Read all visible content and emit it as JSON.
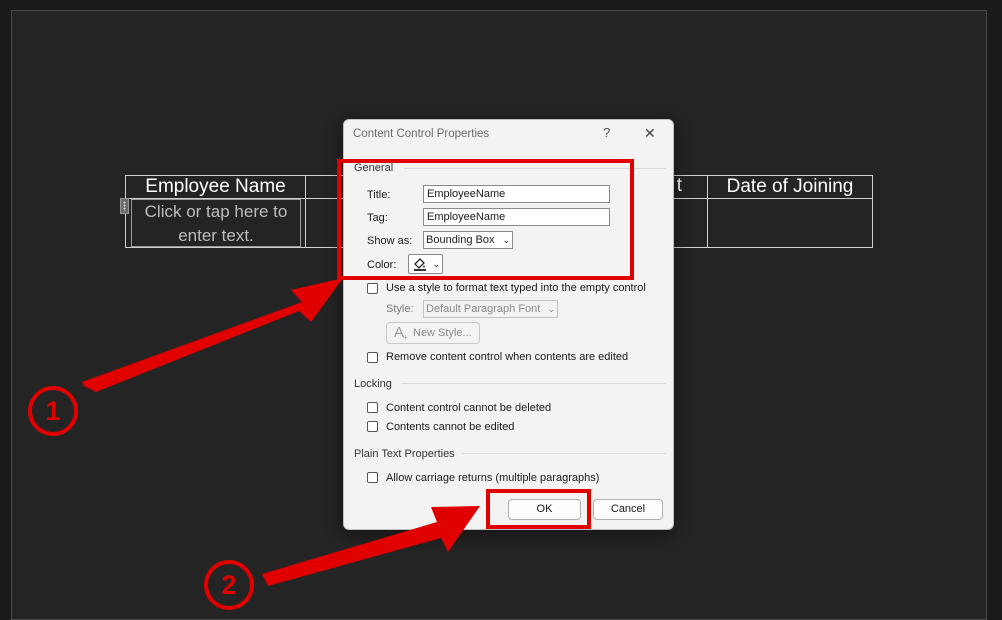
{
  "table": {
    "headers": [
      "Employee Name",
      "",
      "t",
      "Date of Joining"
    ],
    "placeholder_line1": "Click or tap here to",
    "placeholder_line2": "enter text."
  },
  "dialog": {
    "title": "Content Control Properties",
    "help": "?",
    "close": "✕",
    "general": {
      "section_label": "General",
      "title_label": "Title:",
      "title_value": "EmployeeName",
      "tag_label": "Tag:",
      "tag_value": "EmployeeName",
      "show_as_label": "Show as:",
      "show_as_value": "Bounding Box",
      "color_label": "Color:",
      "use_style_label": "Use a style to format text typed into the empty control",
      "style_label": "Style:",
      "style_value": "Default Paragraph Font",
      "new_style_label": "New Style...",
      "remove_label": "Remove content control when contents are edited"
    },
    "locking": {
      "section_label": "Locking",
      "cannot_delete_label": "Content control cannot be deleted",
      "cannot_edit_label": "Contents cannot be edited"
    },
    "plain_text": {
      "section_label": "Plain Text Properties",
      "carriage_label": "Allow carriage returns (multiple paragraphs)"
    },
    "ok_label": "OK",
    "cancel_label": "Cancel"
  },
  "annotations": {
    "step1": "1",
    "step2": "2",
    "highlight_color": "#e00000"
  }
}
